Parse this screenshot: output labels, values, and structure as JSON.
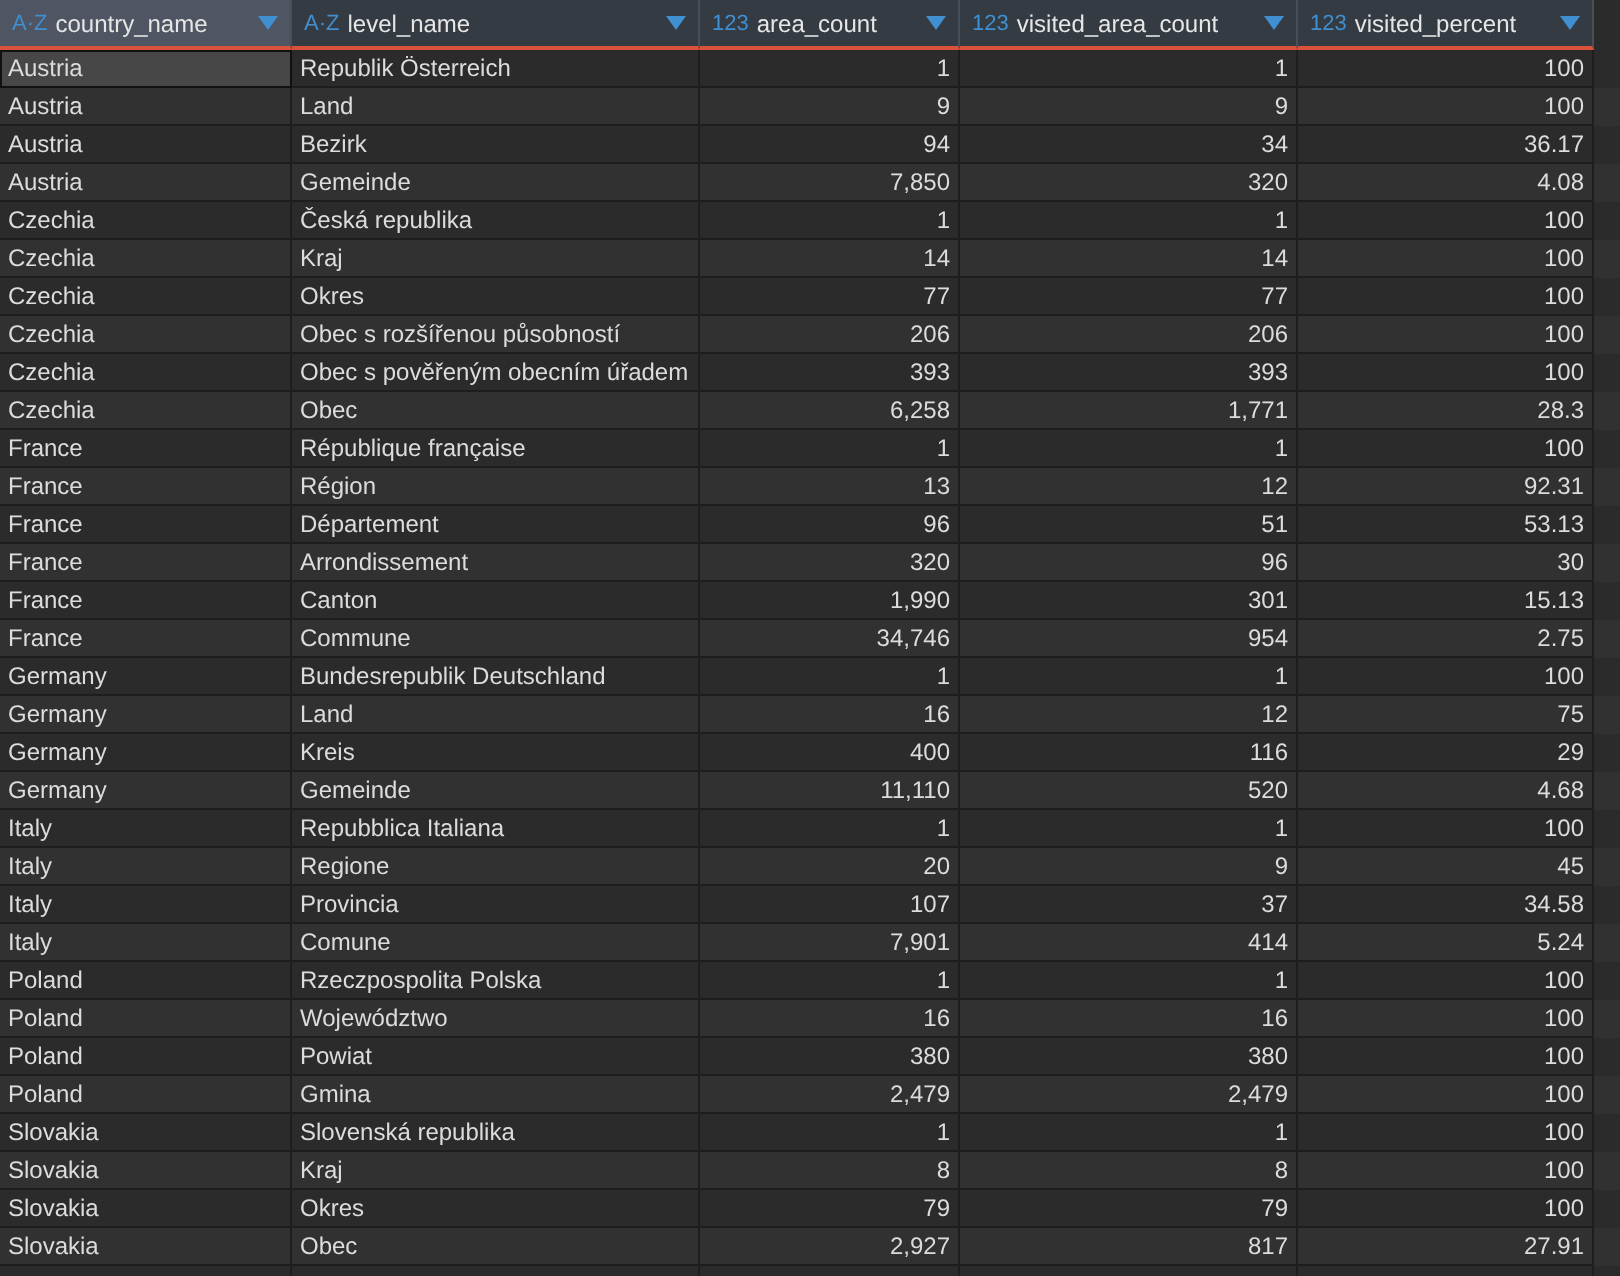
{
  "columns": [
    {
      "type_label": "A·Z",
      "name": "country_name",
      "kind": "text",
      "selected": true
    },
    {
      "type_label": "A·Z",
      "name": "level_name",
      "kind": "text",
      "selected": false
    },
    {
      "type_label": "123",
      "name": "area_count",
      "kind": "number",
      "selected": false
    },
    {
      "type_label": "123",
      "name": "visited_area_count",
      "kind": "number",
      "selected": false
    },
    {
      "type_label": "123",
      "name": "visited_percent",
      "kind": "number",
      "selected": false
    }
  ],
  "rows": [
    {
      "selected": true,
      "cells": [
        "Austria",
        "Republik Österreich",
        "1",
        "1",
        "100"
      ]
    },
    {
      "selected": false,
      "cells": [
        "Austria",
        "Land",
        "9",
        "9",
        "100"
      ]
    },
    {
      "selected": false,
      "cells": [
        "Austria",
        "Bezirk",
        "94",
        "34",
        "36.17"
      ]
    },
    {
      "selected": false,
      "cells": [
        "Austria",
        "Gemeinde",
        "7,850",
        "320",
        "4.08"
      ]
    },
    {
      "selected": false,
      "cells": [
        "Czechia",
        "Česká republika",
        "1",
        "1",
        "100"
      ]
    },
    {
      "selected": false,
      "cells": [
        "Czechia",
        "Kraj",
        "14",
        "14",
        "100"
      ]
    },
    {
      "selected": false,
      "cells": [
        "Czechia",
        "Okres",
        "77",
        "77",
        "100"
      ]
    },
    {
      "selected": false,
      "cells": [
        "Czechia",
        "Obec s rozšířenou působností",
        "206",
        "206",
        "100"
      ]
    },
    {
      "selected": false,
      "cells": [
        "Czechia",
        "Obec s pověřeným obecním úřadem",
        "393",
        "393",
        "100"
      ]
    },
    {
      "selected": false,
      "cells": [
        "Czechia",
        "Obec",
        "6,258",
        "1,771",
        "28.3"
      ]
    },
    {
      "selected": false,
      "cells": [
        "France",
        "République française",
        "1",
        "1",
        "100"
      ]
    },
    {
      "selected": false,
      "cells": [
        "France",
        "Région",
        "13",
        "12",
        "92.31"
      ]
    },
    {
      "selected": false,
      "cells": [
        "France",
        "Département",
        "96",
        "51",
        "53.13"
      ]
    },
    {
      "selected": false,
      "cells": [
        "France",
        "Arrondissement",
        "320",
        "96",
        "30"
      ]
    },
    {
      "selected": false,
      "cells": [
        "France",
        "Canton",
        "1,990",
        "301",
        "15.13"
      ]
    },
    {
      "selected": false,
      "cells": [
        "France",
        "Commune",
        "34,746",
        "954",
        "2.75"
      ]
    },
    {
      "selected": false,
      "cells": [
        "Germany",
        "Bundesrepublik Deutschland",
        "1",
        "1",
        "100"
      ]
    },
    {
      "selected": false,
      "cells": [
        "Germany",
        "Land",
        "16",
        "12",
        "75"
      ]
    },
    {
      "selected": false,
      "cells": [
        "Germany",
        "Kreis",
        "400",
        "116",
        "29"
      ]
    },
    {
      "selected": false,
      "cells": [
        "Germany",
        "Gemeinde",
        "11,110",
        "520",
        "4.68"
      ]
    },
    {
      "selected": false,
      "cells": [
        "Italy",
        "Repubblica Italiana",
        "1",
        "1",
        "100"
      ]
    },
    {
      "selected": false,
      "cells": [
        "Italy",
        "Regione",
        "20",
        "9",
        "45"
      ]
    },
    {
      "selected": false,
      "cells": [
        "Italy",
        "Provincia",
        "107",
        "37",
        "34.58"
      ]
    },
    {
      "selected": false,
      "cells": [
        "Italy",
        "Comune",
        "7,901",
        "414",
        "5.24"
      ]
    },
    {
      "selected": false,
      "cells": [
        "Poland",
        "Rzeczpospolita Polska",
        "1",
        "1",
        "100"
      ]
    },
    {
      "selected": false,
      "cells": [
        "Poland",
        "Województwo",
        "16",
        "16",
        "100"
      ]
    },
    {
      "selected": false,
      "cells": [
        "Poland",
        "Powiat",
        "380",
        "380",
        "100"
      ]
    },
    {
      "selected": false,
      "cells": [
        "Poland",
        "Gmina",
        "2,479",
        "2,479",
        "100"
      ]
    },
    {
      "selected": false,
      "cells": [
        "Slovakia",
        "Slovenská republika",
        "1",
        "1",
        "100"
      ]
    },
    {
      "selected": false,
      "cells": [
        "Slovakia",
        "Kraj",
        "8",
        "8",
        "100"
      ]
    },
    {
      "selected": false,
      "cells": [
        "Slovakia",
        "Okres",
        "79",
        "79",
        "100"
      ]
    },
    {
      "selected": false,
      "cells": [
        "Slovakia",
        "Obec",
        "2,927",
        "817",
        "27.91"
      ]
    }
  ]
}
